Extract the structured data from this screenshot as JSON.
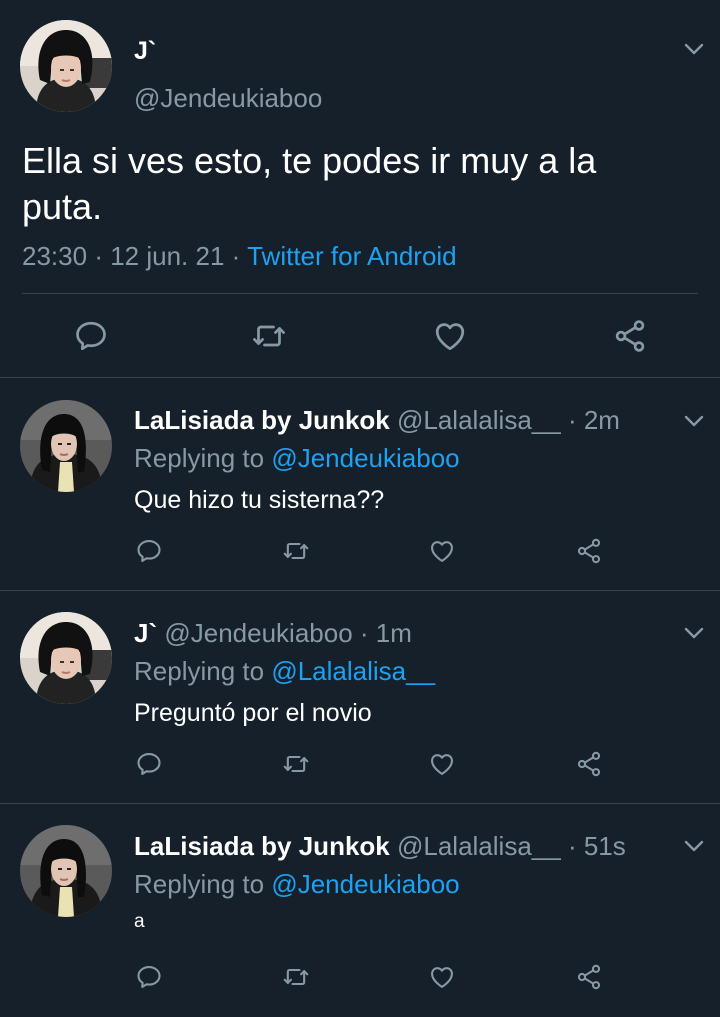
{
  "main_tweet": {
    "author_name": "J`",
    "author_handle": "@Jendeukiaboo",
    "text": "Ella si ves esto, te podes ir muy a la puta.",
    "time": "23:30",
    "separator": "·",
    "date": "12 jun. 21",
    "source": "Twitter for Android",
    "actions": [
      "reply-icon",
      "retweet-icon",
      "like-icon",
      "share-icon"
    ]
  },
  "replies": [
    {
      "author_name": "LaLisiada by Junkok",
      "author_handle": "@Lalalalisa__",
      "time_ago": "· 2m",
      "replying_label": "Replying to",
      "replying_to": "@Jendeukiaboo",
      "text": "Que hizo tu sisterna??"
    },
    {
      "author_name": "J`",
      "author_handle": "@Jendeukiaboo",
      "time_ago": "· 1m",
      "replying_label": "Replying to",
      "replying_to": "@Lalalalisa__",
      "text": "Preguntó por el novio"
    },
    {
      "author_name": "LaLisiada by Junkok",
      "author_handle": "@Lalalalisa__",
      "time_ago": "· 51s",
      "replying_label": "Replying to",
      "replying_to": "@Jendeukiaboo",
      "text": "a"
    }
  ],
  "colors": {
    "background": "#15202b",
    "text": "#ffffff",
    "muted": "#8899a6",
    "link": "#1da1f2",
    "divider": "#38444d"
  }
}
